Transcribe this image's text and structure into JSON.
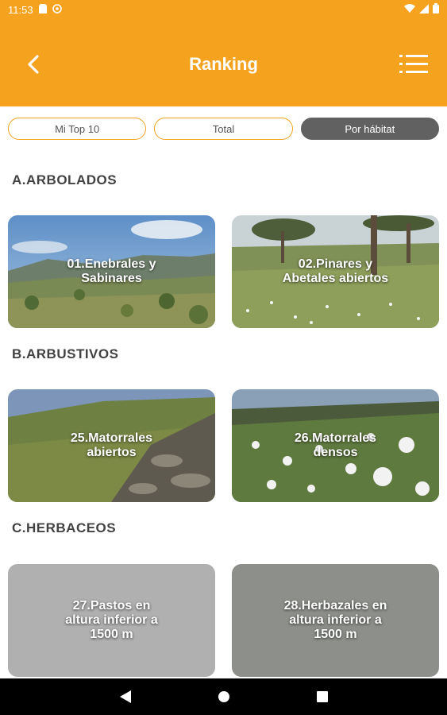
{
  "status": {
    "time": "11:53"
  },
  "app_bar": {
    "title": "Ranking"
  },
  "tabs": [
    {
      "label": "Mi Top 10",
      "active": false
    },
    {
      "label": "Total",
      "active": false
    },
    {
      "label": "Por hábitat",
      "active": true
    }
  ],
  "sections": [
    {
      "title": "A.ARBOLADOS",
      "cards": [
        {
          "label": "01.Enebrales y\nSabinares",
          "image": "hillside-shrubland"
        },
        {
          "label": "02.Pinares y\nAbetales abiertos",
          "image": "open-pine-meadow"
        }
      ]
    },
    {
      "title": "B.ARBUSTIVOS",
      "cards": [
        {
          "label": "25.Matorrales\nabiertos",
          "image": "rocky-slope"
        },
        {
          "label": "26.Matorrales\ndensos",
          "image": "white-flower-shrubs"
        }
      ]
    },
    {
      "title": "C.HERBACEOS",
      "cards": [
        {
          "label": "27.Pastos en\naltura inferior a\n1500 m",
          "image": "gray-placeholder"
        },
        {
          "label": "28.Herbazales en\naltura inferior a\n1500 m",
          "image": "gray-placeholder"
        }
      ]
    }
  ],
  "colors": {
    "accent": "#f5a31f",
    "active_tab": "#616161"
  }
}
